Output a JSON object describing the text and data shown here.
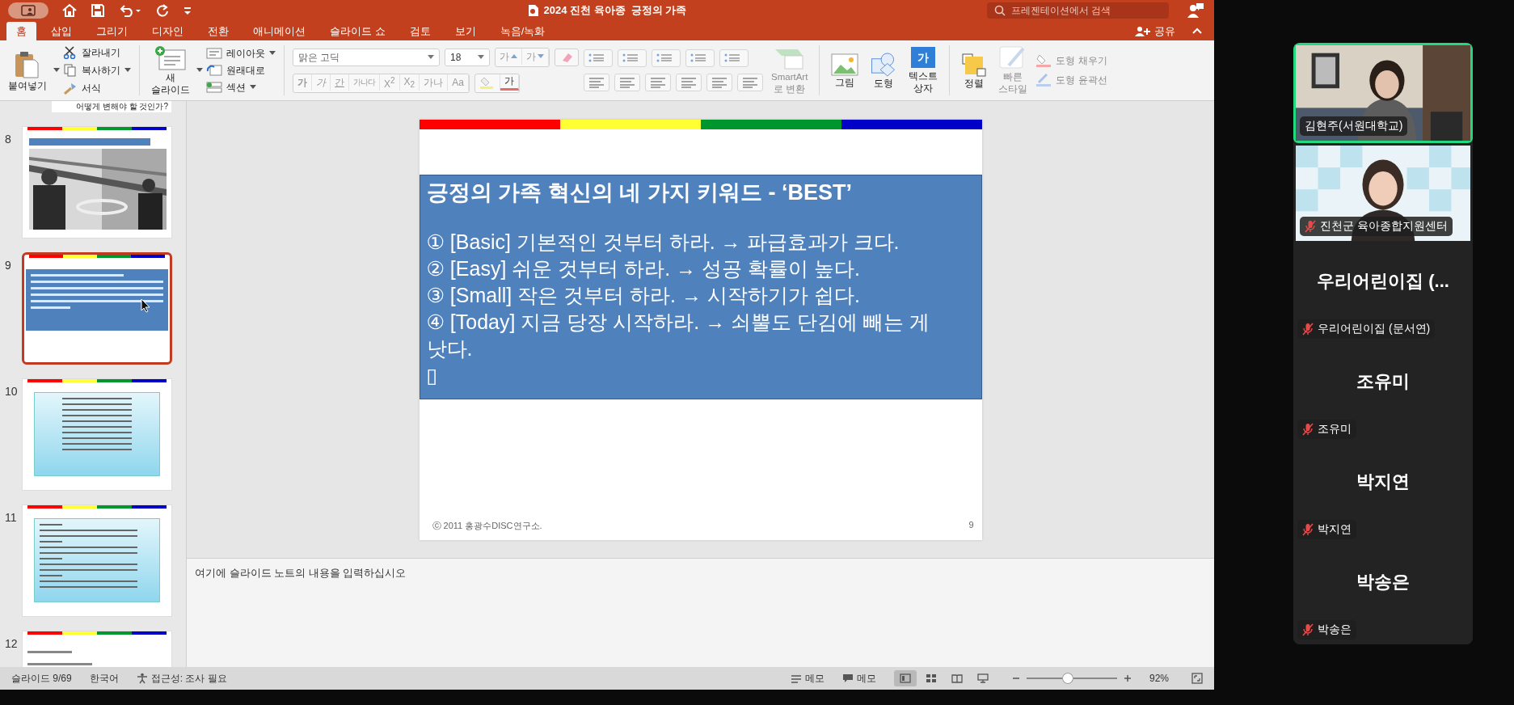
{
  "app_bar": {
    "title": "2024 진천 육아종  긍정의 가족",
    "search": {
      "placeholder": "프레젠테이션에서 검색"
    }
  },
  "ribbon_tabs": [
    {
      "label": "홈",
      "selected": true
    },
    {
      "label": "삽입",
      "selected": false
    },
    {
      "label": "그리기",
      "selected": false
    },
    {
      "label": "디자인",
      "selected": false
    },
    {
      "label": "전환",
      "selected": false
    },
    {
      "label": "애니메이션",
      "selected": false
    },
    {
      "label": "슬라이드 쇼",
      "selected": false
    },
    {
      "label": "검토",
      "selected": false
    },
    {
      "label": "보기",
      "selected": false
    },
    {
      "label": "녹음/녹화",
      "selected": false
    }
  ],
  "share": "공유",
  "ribbon": {
    "paste": "붙여넣기",
    "cut": "잘라내기",
    "copy": "복사하기",
    "format_painter": "서식",
    "new_slide": [
      "새",
      "슬라이드"
    ],
    "layout": "레이아웃",
    "reset": "원래대로",
    "section": "섹션",
    "font_name": "맑은 고딕",
    "font_size": "18",
    "grow": "가",
    "shrink": "가",
    "styles": [
      {
        "kind": "bold",
        "label": "가"
      },
      {
        "kind": "italic",
        "label": "가"
      },
      {
        "kind": "underline",
        "label": "간"
      },
      {
        "kind": "strike",
        "label": "가나다"
      },
      {
        "kind": "plain",
        "label": "X$^{2}$"
      },
      {
        "kind": "plain",
        "label": "X$_{2}$"
      },
      {
        "kind": "spacing",
        "label": "가나"
      },
      {
        "kind": "case",
        "label": "Aa"
      }
    ],
    "font_color": "가",
    "smartart": {
      "lines": [
        "SmartArt",
        "로 변환"
      ],
      "disabled": true
    },
    "picture": "그림",
    "shapes": "도형",
    "textbox": [
      "텍스트",
      "상자"
    ],
    "textbox_glyph": "가",
    "arrange": "정렬",
    "quick_styles": {
      "lines": [
        "빠른",
        "스타일"
      ],
      "disabled": true
    },
    "shape_fill": {
      "label": "도형 채우기",
      "disabled": true
    },
    "shape_outline": {
      "label": "도형 윤곽선",
      "disabled": true
    }
  },
  "thumbnails": {
    "partial_caption": "어떻게 변해야 할 것인가?",
    "slides": [
      {
        "number": "8",
        "selected": false
      },
      {
        "number": "9",
        "kind": "title_box",
        "selected": true
      },
      {
        "number": "10",
        "kind": "centered_list",
        "selected": false
      },
      {
        "number": "11",
        "kind": "bullets",
        "selected": false
      },
      {
        "number": "12",
        "kind": "text",
        "selected": false
      }
    ]
  },
  "slide": {
    "title": "긍정의 가족 혁신의 네 가지 키워드 - ‘BEST’",
    "lines": [
      "① [Basic] 기본적인 것부터 하라. → 파급효과가 크다.",
      "② [Easy] 쉬운 것부터 하라. → 성공 확률이 높다.",
      "③ [Small] 작은 것부터 하라. → 시작하기가 쉽다.",
      "④ [Today] 지금 당장 시작하라. → 쇠뿔도 단김에 빼는 게 낫다.",
      "▯"
    ],
    "footer": "ⓒ 2011 홍광수DISC연구소.",
    "page": "9"
  },
  "notes": {
    "placeholder": "여기에 슬라이드 노트의 내용을 입력하십시오"
  },
  "status_bar": {
    "slide": "슬라이드 9/69",
    "language": "한국어",
    "accessibility": "접근성: 조사 필요",
    "notes_button": "메모",
    "comments_button": "메모",
    "views": [
      {
        "kind": "normal",
        "selected": true
      },
      {
        "kind": "sorter",
        "selected": false
      },
      {
        "kind": "reading",
        "selected": false
      },
      {
        "kind": "slideshow",
        "selected": false
      }
    ],
    "zoom": {
      "level": 0.45,
      "reading": "92%"
    }
  },
  "participants": [
    {
      "kind": "video",
      "name": "김현주(서원대학교)",
      "muted": false,
      "active": true
    },
    {
      "kind": "video",
      "name": "진천군 육아종합지원센터",
      "muted": true,
      "active": false
    },
    {
      "kind": "name",
      "display": "우리어린이집 (...",
      "name": "우리어린이집 (문서연)",
      "muted": true,
      "active": false
    },
    {
      "kind": "name",
      "display": "조유미",
      "name": "조유미",
      "muted": true,
      "active": false
    },
    {
      "kind": "name",
      "display": "박지연",
      "name": "박지연",
      "muted": true,
      "active": false
    },
    {
      "kind": "name",
      "display": "박송은",
      "name": "박송은",
      "muted": true,
      "active": false
    }
  ]
}
